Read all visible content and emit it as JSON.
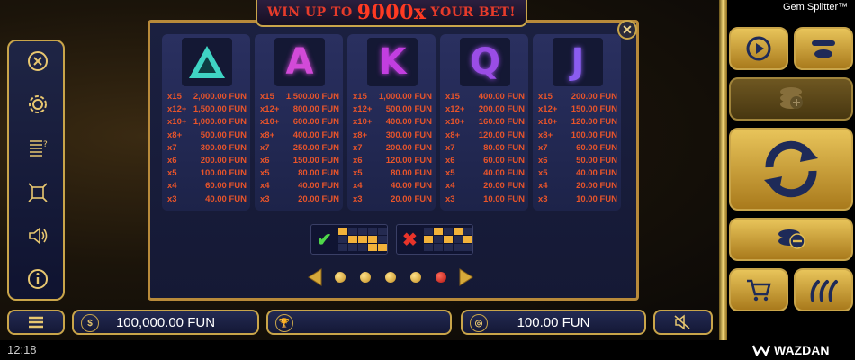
{
  "banner": {
    "prefix": "WIN UP TO",
    "amount": "9000x",
    "suffix": "YOUR BET!"
  },
  "game_title": "Gem Splitter™",
  "status_bar": {
    "time": "12:18",
    "brand": "WAZDAN"
  },
  "paytable": [
    {
      "symbol": "triangle-gem",
      "letter": "",
      "color": "#3fd4c4",
      "rows": [
        {
          "mult": "x15",
          "amount": "2,000.00 FUN"
        },
        {
          "mult": "x12+",
          "amount": "1,500.00 FUN"
        },
        {
          "mult": "x10+",
          "amount": "1,000.00 FUN"
        },
        {
          "mult": "x8+",
          "amount": "500.00 FUN"
        },
        {
          "mult": "x7",
          "amount": "300.00 FUN"
        },
        {
          "mult": "x6",
          "amount": "200.00 FUN"
        },
        {
          "mult": "x5",
          "amount": "100.00 FUN"
        },
        {
          "mult": "x4",
          "amount": "60.00 FUN"
        },
        {
          "mult": "x3",
          "amount": "40.00 FUN"
        }
      ]
    },
    {
      "symbol": "letter-a-gem",
      "letter": "A",
      "color": "#d24ad8",
      "rows": [
        {
          "mult": "x15",
          "amount": "1,500.00 FUN"
        },
        {
          "mult": "x12+",
          "amount": "800.00 FUN"
        },
        {
          "mult": "x10+",
          "amount": "600.00 FUN"
        },
        {
          "mult": "x8+",
          "amount": "400.00 FUN"
        },
        {
          "mult": "x7",
          "amount": "250.00 FUN"
        },
        {
          "mult": "x6",
          "amount": "150.00 FUN"
        },
        {
          "mult": "x5",
          "amount": "80.00 FUN"
        },
        {
          "mult": "x4",
          "amount": "40.00 FUN"
        },
        {
          "mult": "x3",
          "amount": "20.00 FUN"
        }
      ]
    },
    {
      "symbol": "letter-k-gem",
      "letter": "K",
      "color": "#c23ee0",
      "rows": [
        {
          "mult": "x15",
          "amount": "1,000.00 FUN"
        },
        {
          "mult": "x12+",
          "amount": "500.00 FUN"
        },
        {
          "mult": "x10+",
          "amount": "400.00 FUN"
        },
        {
          "mult": "x8+",
          "amount": "300.00 FUN"
        },
        {
          "mult": "x7",
          "amount": "200.00 FUN"
        },
        {
          "mult": "x6",
          "amount": "120.00 FUN"
        },
        {
          "mult": "x5",
          "amount": "80.00 FUN"
        },
        {
          "mult": "x4",
          "amount": "40.00 FUN"
        },
        {
          "mult": "x3",
          "amount": "20.00 FUN"
        }
      ]
    },
    {
      "symbol": "letter-q-gem",
      "letter": "Q",
      "color": "#9a4de6",
      "rows": [
        {
          "mult": "x15",
          "amount": "400.00 FUN"
        },
        {
          "mult": "x12+",
          "amount": "200.00 FUN"
        },
        {
          "mult": "x10+",
          "amount": "160.00 FUN"
        },
        {
          "mult": "x8+",
          "amount": "120.00 FUN"
        },
        {
          "mult": "x7",
          "amount": "80.00 FUN"
        },
        {
          "mult": "x6",
          "amount": "60.00 FUN"
        },
        {
          "mult": "x5",
          "amount": "40.00 FUN"
        },
        {
          "mult": "x4",
          "amount": "20.00 FUN"
        },
        {
          "mult": "x3",
          "amount": "10.00 FUN"
        }
      ]
    },
    {
      "symbol": "letter-j-gem",
      "letter": "J",
      "color": "#8a5cf0",
      "rows": [
        {
          "mult": "x15",
          "amount": "200.00 FUN"
        },
        {
          "mult": "x12+",
          "amount": "150.00 FUN"
        },
        {
          "mult": "x10+",
          "amount": "120.00 FUN"
        },
        {
          "mult": "x8+",
          "amount": "100.00 FUN"
        },
        {
          "mult": "x7",
          "amount": "60.00 FUN"
        },
        {
          "mult": "x6",
          "amount": "50.00 FUN"
        },
        {
          "mult": "x5",
          "amount": "40.00 FUN"
        },
        {
          "mult": "x4",
          "amount": "20.00 FUN"
        },
        {
          "mult": "x3",
          "amount": "10.00 FUN"
        }
      ]
    }
  ],
  "directions": {
    "valid": {
      "mark": "✔",
      "color": "#4fd84a"
    },
    "invalid": {
      "mark": "✖",
      "color": "#e8342a"
    }
  },
  "pager": {
    "pages": 5,
    "active": 5
  },
  "bottom": {
    "balance": "100,000.00 FUN",
    "win": "",
    "bet": "100.00 FUN"
  },
  "left_menu": [
    "close-icon",
    "settings-icon",
    "paytable-icon",
    "fullscreen-icon",
    "sound-icon",
    "info-icon"
  ],
  "colors": {
    "gold": "#c9a54a",
    "payout": "#e8542a",
    "panel": "#1b2040"
  }
}
